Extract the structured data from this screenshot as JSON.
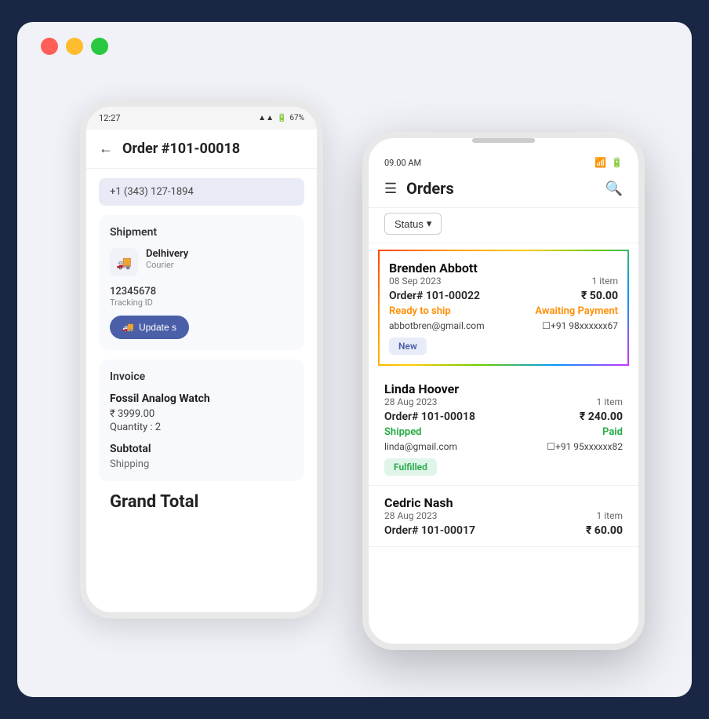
{
  "window": {
    "bg_color": "#1a2744",
    "container_bg": "#f0f2f8"
  },
  "traffic_lights": {
    "red": "#ff5f57",
    "yellow": "#febc2e",
    "green": "#28c840"
  },
  "phone_back": {
    "status_time": "12:27",
    "status_battery": "67%",
    "order_title": "Order #101-00018",
    "phone_number": "+1 (343) 127-1894",
    "shipment_section_title": "Shipment",
    "courier_name": "Delhivery",
    "courier_type": "Courier",
    "tracking_id_value": "12345678",
    "tracking_id_label": "Tracking ID",
    "update_btn_label": "Update s",
    "invoice_section_title": "Invoice",
    "product_name": "Fossil Analog Watch",
    "product_price": "₹ 3999.00",
    "product_qty": "Quantity : 2",
    "subtotal_label": "Subtotal",
    "shipping_label": "Shipping",
    "grand_total_label": "Grand Total"
  },
  "phone_front": {
    "status_time": "09.00 AM",
    "page_title": "Orders",
    "status_filter_label": "Status",
    "orders": [
      {
        "customer": "Brenden Abbott",
        "date": "08 Sep 2023",
        "order_num": "Order# 101-00022",
        "items": "1 item",
        "amount": "₹ 50.00",
        "status_left": "Ready to ship",
        "status_right": "Awaiting Payment",
        "email": "abbotbren@gmail.com",
        "phone": "☐+91 98xxxxxx67",
        "badge": "New",
        "highlighted": true,
        "status_left_color": "orange",
        "status_right_color": "orange"
      },
      {
        "customer": "Linda Hoover",
        "date": "28 Aug 2023",
        "order_num": "Order# 101-00018",
        "items": "1 item",
        "amount": "₹ 240.00",
        "status_left": "Shipped",
        "status_right": "Paid",
        "email": "linda@gmail.com",
        "phone": "☐+91 95xxxxxx82",
        "badge": "Fulfilled",
        "highlighted": false,
        "status_left_color": "green",
        "status_right_color": "green"
      },
      {
        "customer": "Cedric Nash",
        "date": "28 Aug 2023",
        "order_num": "Order# 101-00017",
        "items": "1 item",
        "amount": "₹ 60.00",
        "status_left": "",
        "status_right": "",
        "email": "",
        "phone": "",
        "badge": "",
        "highlighted": false,
        "status_left_color": "",
        "status_right_color": ""
      }
    ]
  }
}
